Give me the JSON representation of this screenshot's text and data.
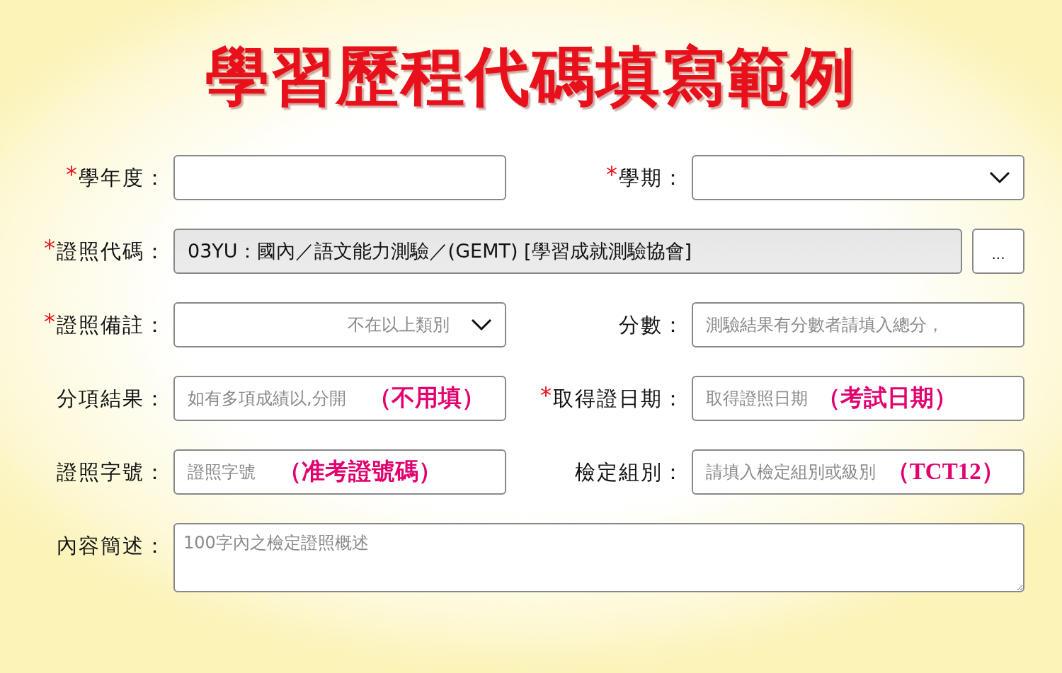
{
  "title": "學習歷程代碼填寫範例",
  "rows": [
    {
      "fields": [
        {
          "required_mark": "*",
          "label": "學年度：",
          "kind": "text"
        },
        {
          "required_mark": "*",
          "label": "學期：",
          "kind": "select"
        }
      ]
    },
    {
      "fields": [
        {
          "required_mark": "*",
          "label": "證照代碼：",
          "kind": "lookup",
          "value": "03YU：國內／語文能力測驗／(GEMT) [學習成就測驗協會]",
          "button": "..."
        }
      ]
    },
    {
      "fields": [
        {
          "required_mark": "*",
          "label": "證照備註：",
          "kind": "select",
          "value": "不在以上類別"
        },
        {
          "label": "分數：",
          "kind": "text",
          "placeholder": "測驗結果有分數者請填入總分，"
        }
      ]
    },
    {
      "fields": [
        {
          "label": "分項結果：",
          "kind": "text",
          "placeholder": "如有多項成績以,分開",
          "annotation": "（不用填）"
        },
        {
          "required_mark": "*",
          "label": "取得證日期：",
          "kind": "text",
          "placeholder": "取得證照日期",
          "annotation": "（考試日期）"
        }
      ]
    },
    {
      "fields": [
        {
          "label": "證照字號：",
          "kind": "text",
          "placeholder": "證照字號",
          "annotation": "（准考證號碼）"
        },
        {
          "label": "檢定組別：",
          "kind": "text",
          "placeholder": "請填入檢定組別或級別",
          "annotation": "（TCT12）"
        }
      ]
    },
    {
      "fields": [
        {
          "label": "內容簡述：",
          "kind": "textarea",
          "placeholder": "100字內之檢定證照概述"
        }
      ]
    }
  ]
}
